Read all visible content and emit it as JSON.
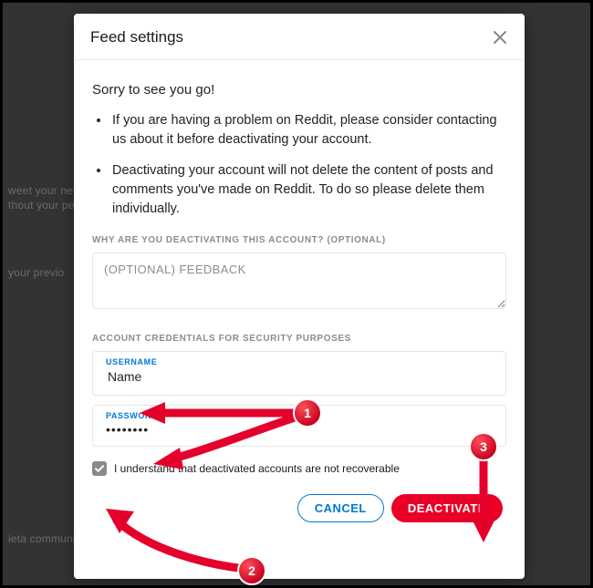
{
  "side": {
    "a": "weet your nee",
    "b": "thout your pe",
    "c": "your previo",
    "d": "ieta communi"
  },
  "modal": {
    "title": "Feed settings",
    "sorry": "Sorry to see you go!",
    "notes": [
      "If you are having a problem on Reddit, please consider contacting us about it before deactivating your account.",
      "Deactivating your account will not delete the content of posts and comments you've made on Reddit. To do so please delete them individually."
    ],
    "why_label": "WHY ARE YOU DEACTIVATING THIS ACCOUNT? (OPTIONAL)",
    "feedback_placeholder": "(OPTIONAL) FEEDBACK",
    "cred_label": "ACCOUNT CREDENTIALS FOR SECURITY PURPOSES",
    "username_label": "USERNAME",
    "username_value": "Name",
    "password_label": "PASSWORD",
    "password_value": "••••••••",
    "ack_label": "I understand that deactivated accounts are not recoverable",
    "ack_checked": true,
    "cancel": "CANCEL",
    "deactivate": "DEACTIVATE"
  },
  "annotations": {
    "badge1": "1",
    "badge2": "2",
    "badge3": "3",
    "color": "#e4002b"
  }
}
